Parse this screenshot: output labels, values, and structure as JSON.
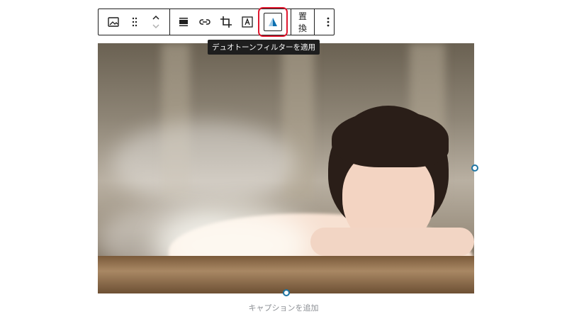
{
  "toolbar": {
    "items": [
      {
        "name": "image-block-icon"
      },
      {
        "name": "drag-handle-icon"
      },
      {
        "name": "move-up-down-icon"
      },
      {
        "name": "align-icon"
      },
      {
        "name": "link-icon"
      },
      {
        "name": "crop-icon"
      },
      {
        "name": "text-overlay-icon"
      },
      {
        "name": "duotone-filter-icon"
      }
    ],
    "replace_label": "置換",
    "more_icon": "more-vertical-icon"
  },
  "tooltip": {
    "text": "デュオトーンフィルターを適用"
  },
  "highlight_color": "#e0182f",
  "accent_color": "#1e75a3",
  "caption": {
    "placeholder": "キャプションを追加"
  }
}
